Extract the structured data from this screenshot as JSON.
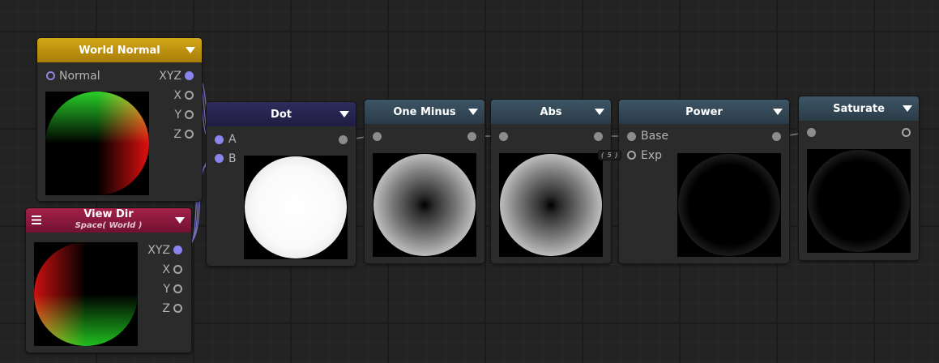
{
  "nodes": {
    "world_normal": {
      "title": "World Normal",
      "input": "Normal",
      "outputs": [
        "XYZ",
        "X",
        "Y",
        "Z"
      ]
    },
    "view_dir": {
      "title": "View Dir",
      "subtitle": "Space( World )",
      "outputs": [
        "XYZ",
        "X",
        "Y",
        "Z"
      ]
    },
    "dot": {
      "title": "Dot",
      "inputs": [
        "A",
        "B"
      ]
    },
    "one_minus": {
      "title": "One Minus"
    },
    "abs": {
      "title": "Abs"
    },
    "power": {
      "title": "Power",
      "inputs": [
        "Base",
        "Exp"
      ],
      "exp_value": "( 5 )"
    },
    "saturate": {
      "title": "Saturate"
    }
  },
  "colors": {
    "header_world_normal": "#c2950f",
    "header_view_dir": "#8e1a3d",
    "header_dot": "#26244d",
    "header_operators": "#344957",
    "port_vector": "#8a84ee",
    "port_scalar": "#8c8c8c",
    "wire_vector": "#7a74c9"
  },
  "icons": [
    "dropdown-arrow-icon",
    "menu-icon"
  ]
}
